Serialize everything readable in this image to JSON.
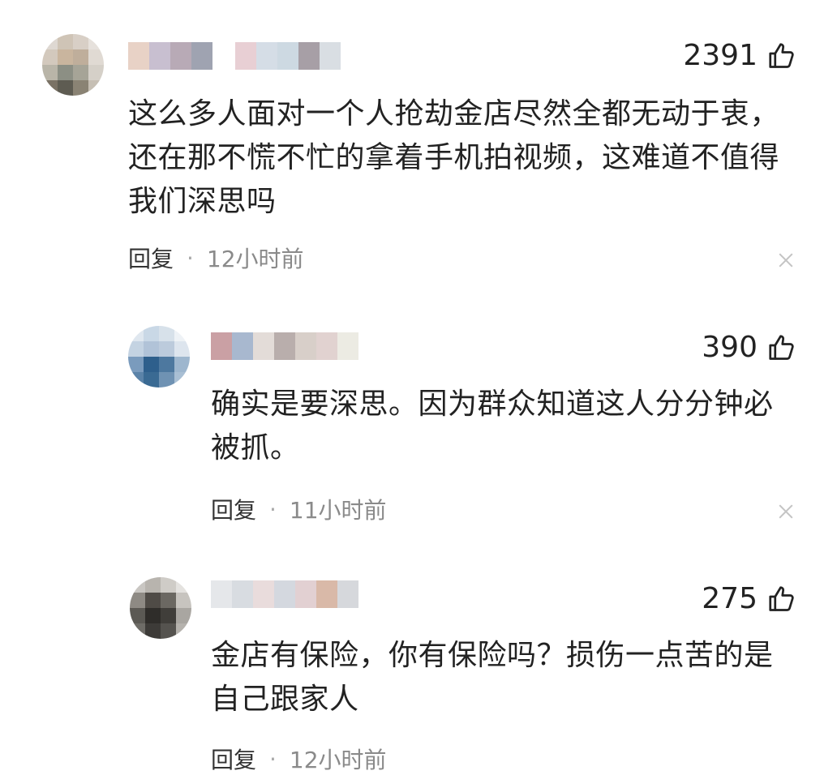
{
  "comments": [
    {
      "likes": "2391",
      "text": "这么多人面对一个人抢劫金店尽然全都无动于衷，还在那不慌不忙的拿着手机拍视频，这难道不值得我们深思吗",
      "reply_label": "回复",
      "separator": "·",
      "time": "12小时前"
    },
    {
      "likes": "390",
      "text": "确实是要深思。因为群众知道这人分分钟必被抓。",
      "reply_label": "回复",
      "separator": "·",
      "time": "11小时前"
    },
    {
      "likes": "275",
      "text": "金店有保险，你有保险吗？损伤一点苦的是自己跟家人",
      "reply_label": "回复",
      "separator": "·",
      "time": "12小时前"
    }
  ],
  "icons": {
    "like": "thumbs-up-icon",
    "close": "close-icon"
  },
  "colors": {
    "text": "#222222",
    "meta": "#8a8a8a"
  }
}
